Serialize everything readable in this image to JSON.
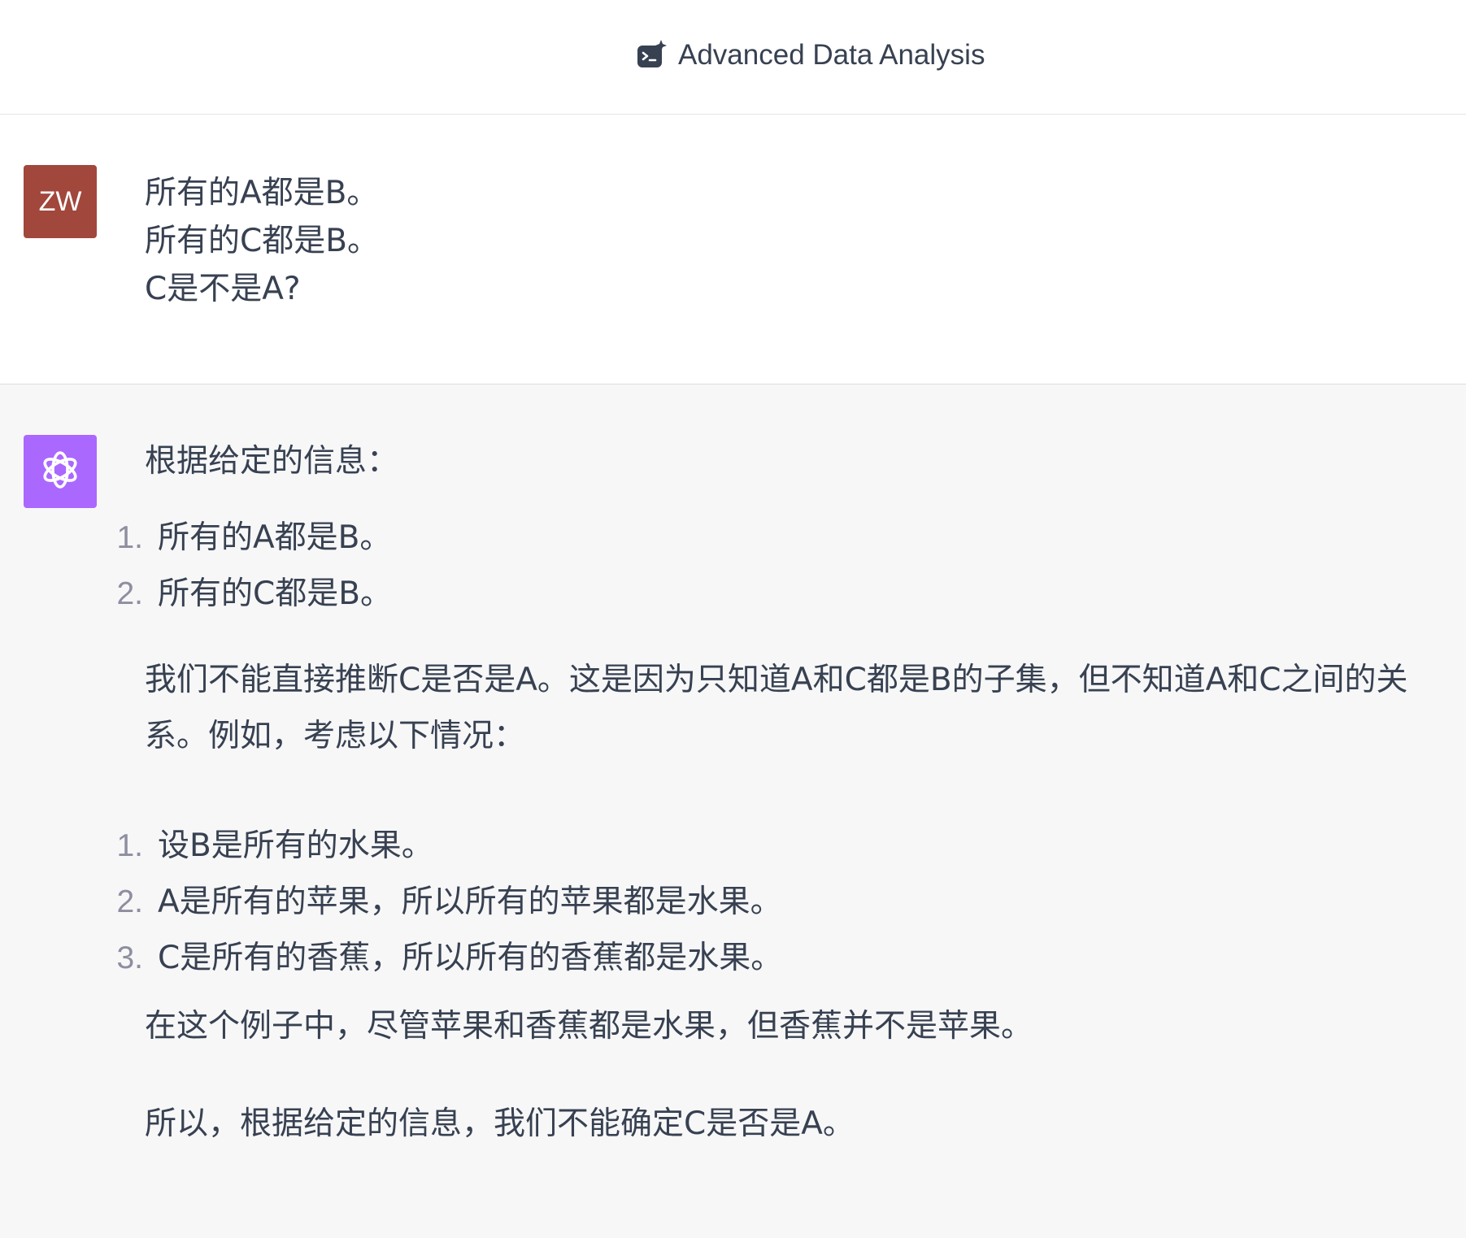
{
  "header": {
    "model_name": "Advanced Data Analysis",
    "model_icon": "data-analysis-icon"
  },
  "user_message": {
    "avatar_initials": "ZW",
    "avatar_color": "#a1473c",
    "lines": [
      "所有的A都是B。",
      "所有的C都是B。",
      "C是不是A?"
    ]
  },
  "assistant_message": {
    "avatar_icon": "openai-logo-icon",
    "avatar_color": "#ab68ff",
    "intro": "根据给定的信息：",
    "premises": [
      {
        "num": "1.",
        "text": "所有的A都是B。"
      },
      {
        "num": "2.",
        "text": "所有的C都是B。"
      }
    ],
    "explanation_line1": "我们不能直接推断C是否是A。这是因为只知道A和C都是B的子集，但不知道A和C之间的关",
    "explanation_line2": "系。例如，考虑以下情况：",
    "example": [
      {
        "num": "1.",
        "text": "设B是所有的水果。"
      },
      {
        "num": "2.",
        "text": "A是所有的苹果，所以所有的苹果都是水果。"
      },
      {
        "num": "3.",
        "text": "C是所有的香蕉，所以所有的香蕉都是水果。"
      }
    ],
    "example_note": "在这个例子中，尽管苹果和香蕉都是水果，但香蕉并不是苹果。",
    "conclusion": "所以，根据给定的信息，我们不能确定C是否是A。"
  }
}
